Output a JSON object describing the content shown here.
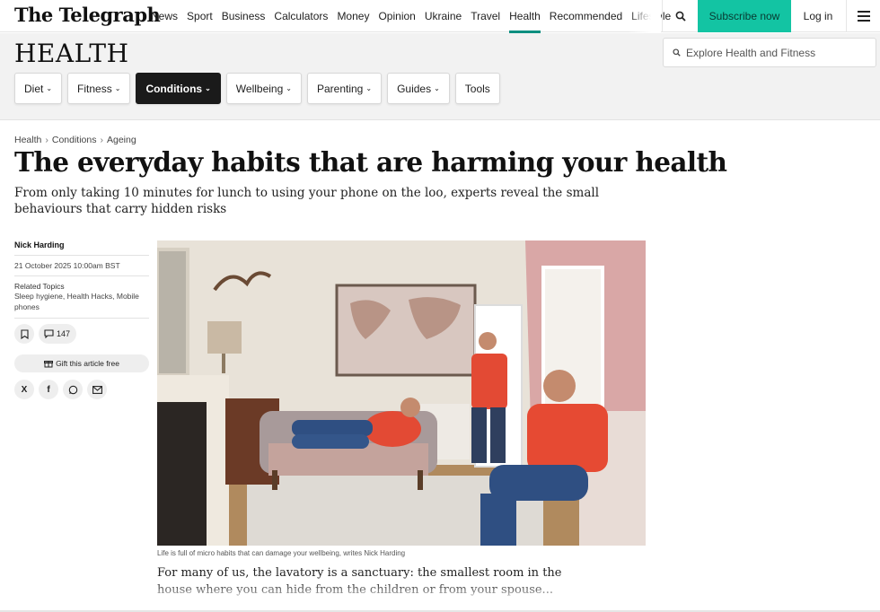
{
  "nav": {
    "logo": "The Telegraph",
    "links": [
      "News",
      "Sport",
      "Business",
      "Calculators",
      "Money",
      "Opinion",
      "Ukraine",
      "Travel",
      "Health",
      "Recommended",
      "Lifestyle"
    ],
    "active_link": "Health",
    "subscribe_label": "Subscribe now",
    "login_label": "Log in",
    "icons": {
      "search": "search-icon",
      "menu": "hamburger-menu-icon"
    }
  },
  "section": {
    "title": "HEALTH",
    "explore_placeholder": "Explore Health and Fitness",
    "pills": [
      {
        "label": "Diet",
        "has_chevron": true,
        "selected": false
      },
      {
        "label": "Fitness",
        "has_chevron": true,
        "selected": false
      },
      {
        "label": "Conditions",
        "has_chevron": true,
        "selected": true
      },
      {
        "label": "Wellbeing",
        "has_chevron": true,
        "selected": false
      },
      {
        "label": "Parenting",
        "has_chevron": true,
        "selected": false
      },
      {
        "label": "Guides",
        "has_chevron": true,
        "selected": false
      },
      {
        "label": "Tools",
        "has_chevron": false,
        "selected": false
      }
    ]
  },
  "article": {
    "breadcrumb": [
      "Health",
      "Conditions",
      "Ageing"
    ],
    "headline": "The everyday habits that are harming your health",
    "standfirst": "From only taking 10 minutes for lunch to using your phone on the loo, experts reveal the small behaviours that carry hidden risks",
    "author": "Nick Harding",
    "date": "21 October 2025 10:00am BST",
    "related_label": "Related Topics",
    "related_topics": "Sleep hygiene, Health Hacks, Mobile phones",
    "comment_count": "147",
    "gift_label": "Gift this article free",
    "share_icons": [
      "x-icon",
      "facebook-icon",
      "whatsapp-icon",
      "email-icon"
    ],
    "share_glyphs": {
      "x": "X",
      "facebook": "f"
    },
    "caption": "Life is full of micro habits that can damage your wellbeing, writes Nick Harding",
    "body_intro": "For many of us, the lavatory is a sanctuary: the smallest room in the house where you can hide from the children or from your spouse..."
  },
  "colors": {
    "accent": "#13c4a3",
    "active_underline": "#0a8f80",
    "section_bg": "#f2f2f2",
    "selected_pill": "#1a1a1a"
  }
}
